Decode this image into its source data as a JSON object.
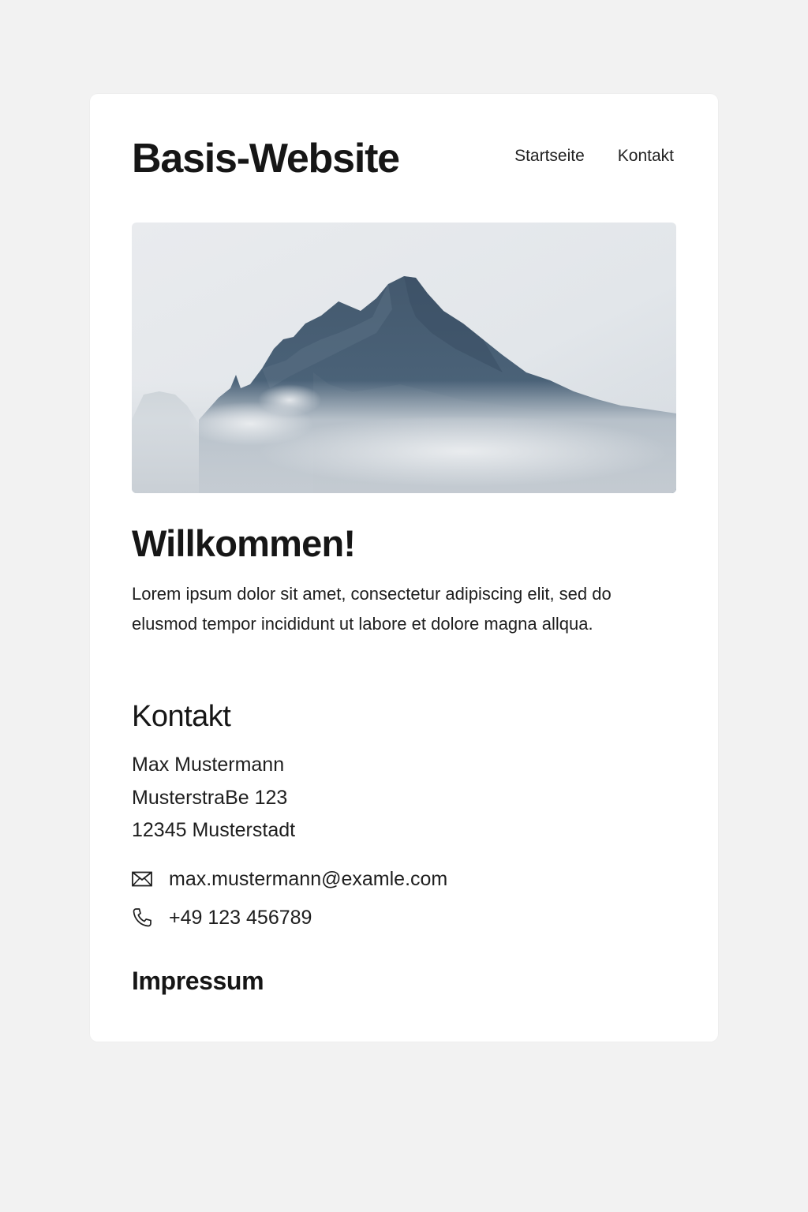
{
  "header": {
    "title": "Basis-Website",
    "nav": [
      {
        "label": "Startseite"
      },
      {
        "label": "Kontakt"
      }
    ]
  },
  "hero": {
    "image": "mountain-peak-in-mist"
  },
  "welcome": {
    "title": "Willkommen!",
    "text": "Lorem ipsum dolor sit amet, consectetur adipiscing elit, sed do elusmod tempor incididunt ut labore et dolore magna allqua."
  },
  "contact": {
    "title": "Kontakt",
    "name": "Max Mustermann",
    "street": "MusterstraBe 123",
    "city": "12345 Musterstadt",
    "email": "max.mustermann@examle.com",
    "phone": "+49 123 456789",
    "email_icon": "envelope-icon",
    "phone_icon": "phone-icon"
  },
  "footer": {
    "impressum": "Impressum"
  },
  "colors": {
    "background": "#f2f2f2",
    "card": "#ffffff",
    "text": "#1a1a1a",
    "mountain": "#3f566d",
    "sky": "#e6e9ed"
  }
}
